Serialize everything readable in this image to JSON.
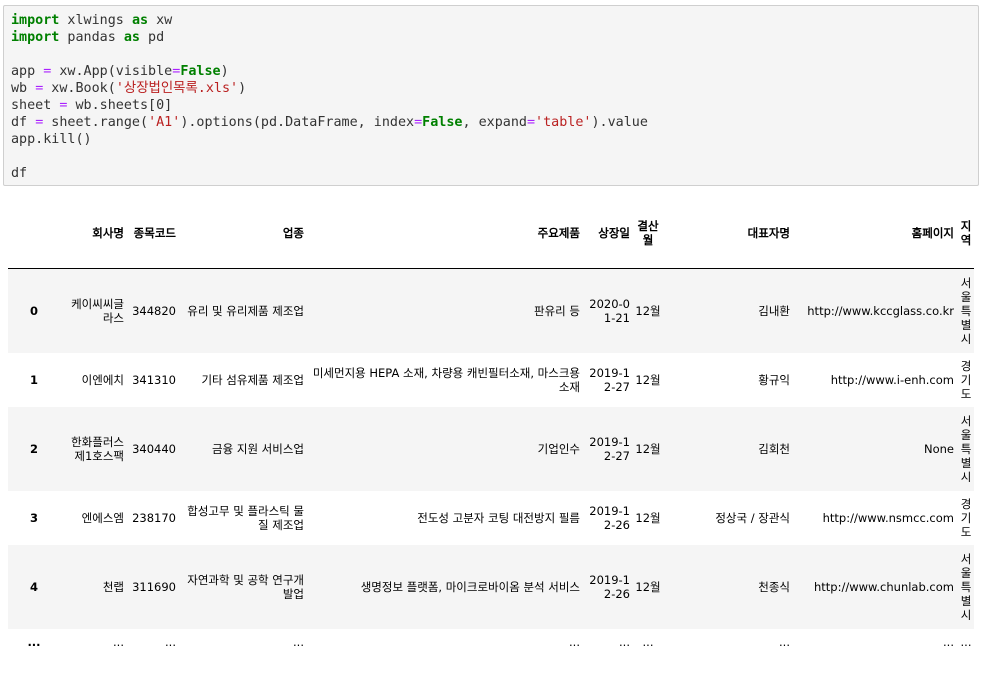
{
  "code": {
    "lines": [
      [
        {
          "t": "import",
          "c": "kw"
        },
        {
          "t": " xlwings "
        },
        {
          "t": "as",
          "c": "kw"
        },
        {
          "t": " xw"
        }
      ],
      [
        {
          "t": "import",
          "c": "kw"
        },
        {
          "t": " pandas "
        },
        {
          "t": "as",
          "c": "kw"
        },
        {
          "t": " pd"
        }
      ],
      [],
      [
        {
          "t": "app "
        },
        {
          "t": "=",
          "c": "op"
        },
        {
          "t": " xw.App(visible"
        },
        {
          "t": "=",
          "c": "op"
        },
        {
          "t": "False",
          "c": "kw"
        },
        {
          "t": ")"
        }
      ],
      [
        {
          "t": "wb "
        },
        {
          "t": "=",
          "c": "op"
        },
        {
          "t": " xw.Book("
        },
        {
          "t": "'상장법인목록.xls'",
          "c": "str"
        },
        {
          "t": ")"
        }
      ],
      [
        {
          "t": "sheet "
        },
        {
          "t": "=",
          "c": "op"
        },
        {
          "t": " wb.sheets[0]"
        }
      ],
      [
        {
          "t": "df "
        },
        {
          "t": "=",
          "c": "op"
        },
        {
          "t": " sheet.range("
        },
        {
          "t": "'A1'",
          "c": "str"
        },
        {
          "t": ").options(pd.DataFrame, index"
        },
        {
          "t": "=",
          "c": "op"
        },
        {
          "t": "False",
          "c": "kw"
        },
        {
          "t": ", expand"
        },
        {
          "t": "=",
          "c": "op"
        },
        {
          "t": "'table'",
          "c": "str"
        },
        {
          "t": ").value"
        }
      ],
      [
        {
          "t": "app.kill()"
        }
      ],
      [],
      [
        {
          "t": "df"
        }
      ]
    ]
  },
  "table": {
    "columns": [
      "",
      "회사명",
      "종목코드",
      "업종",
      "주요제품",
      "상장일",
      "결산월",
      "대표자명",
      "홈페이지",
      "지역"
    ],
    "rows": [
      [
        "0",
        "케이씨씨글라스",
        "344820",
        "유리 및 유리제품 제조업",
        "판유리 등",
        "2020-01-21",
        "12월",
        "김내환",
        "http://www.kccglass.co.kr",
        "서울특별시"
      ],
      [
        "1",
        "이엔에치",
        "341310",
        "기타 섬유제품 제조업",
        "미세먼지용 HEPA 소재, 차량용 캐빈필터소재, 마스크용 소재",
        "2019-12-27",
        "12월",
        "황규익",
        "http://www.i-enh.com",
        "경기도"
      ],
      [
        "2",
        "한화플러스제1호스팩",
        "340440",
        "금융 지원 서비스업",
        "기업인수",
        "2019-12-27",
        "12월",
        "김회천",
        "None",
        "서울특별시"
      ],
      [
        "3",
        "엔에스엠",
        "238170",
        "합성고무 및 플라스틱 물질 제조업",
        "전도성 고분자 코팅 대전방지 필름",
        "2019-12-26",
        "12월",
        "정상국 / 장관식",
        "http://www.nsmcc.com",
        "경기도"
      ],
      [
        "4",
        "천랩",
        "311690",
        "자연과학 및 공학 연구개발업",
        "생명정보 플랫폼, 마이크로바이옴 분석 서비스",
        "2019-12-26",
        "12월",
        "천종식",
        "http://www.chunlab.com",
        "서울특별시"
      ],
      [
        "...",
        "...",
        "...",
        "...",
        "...",
        "...",
        "...",
        "...",
        "...",
        "..."
      ]
    ]
  }
}
